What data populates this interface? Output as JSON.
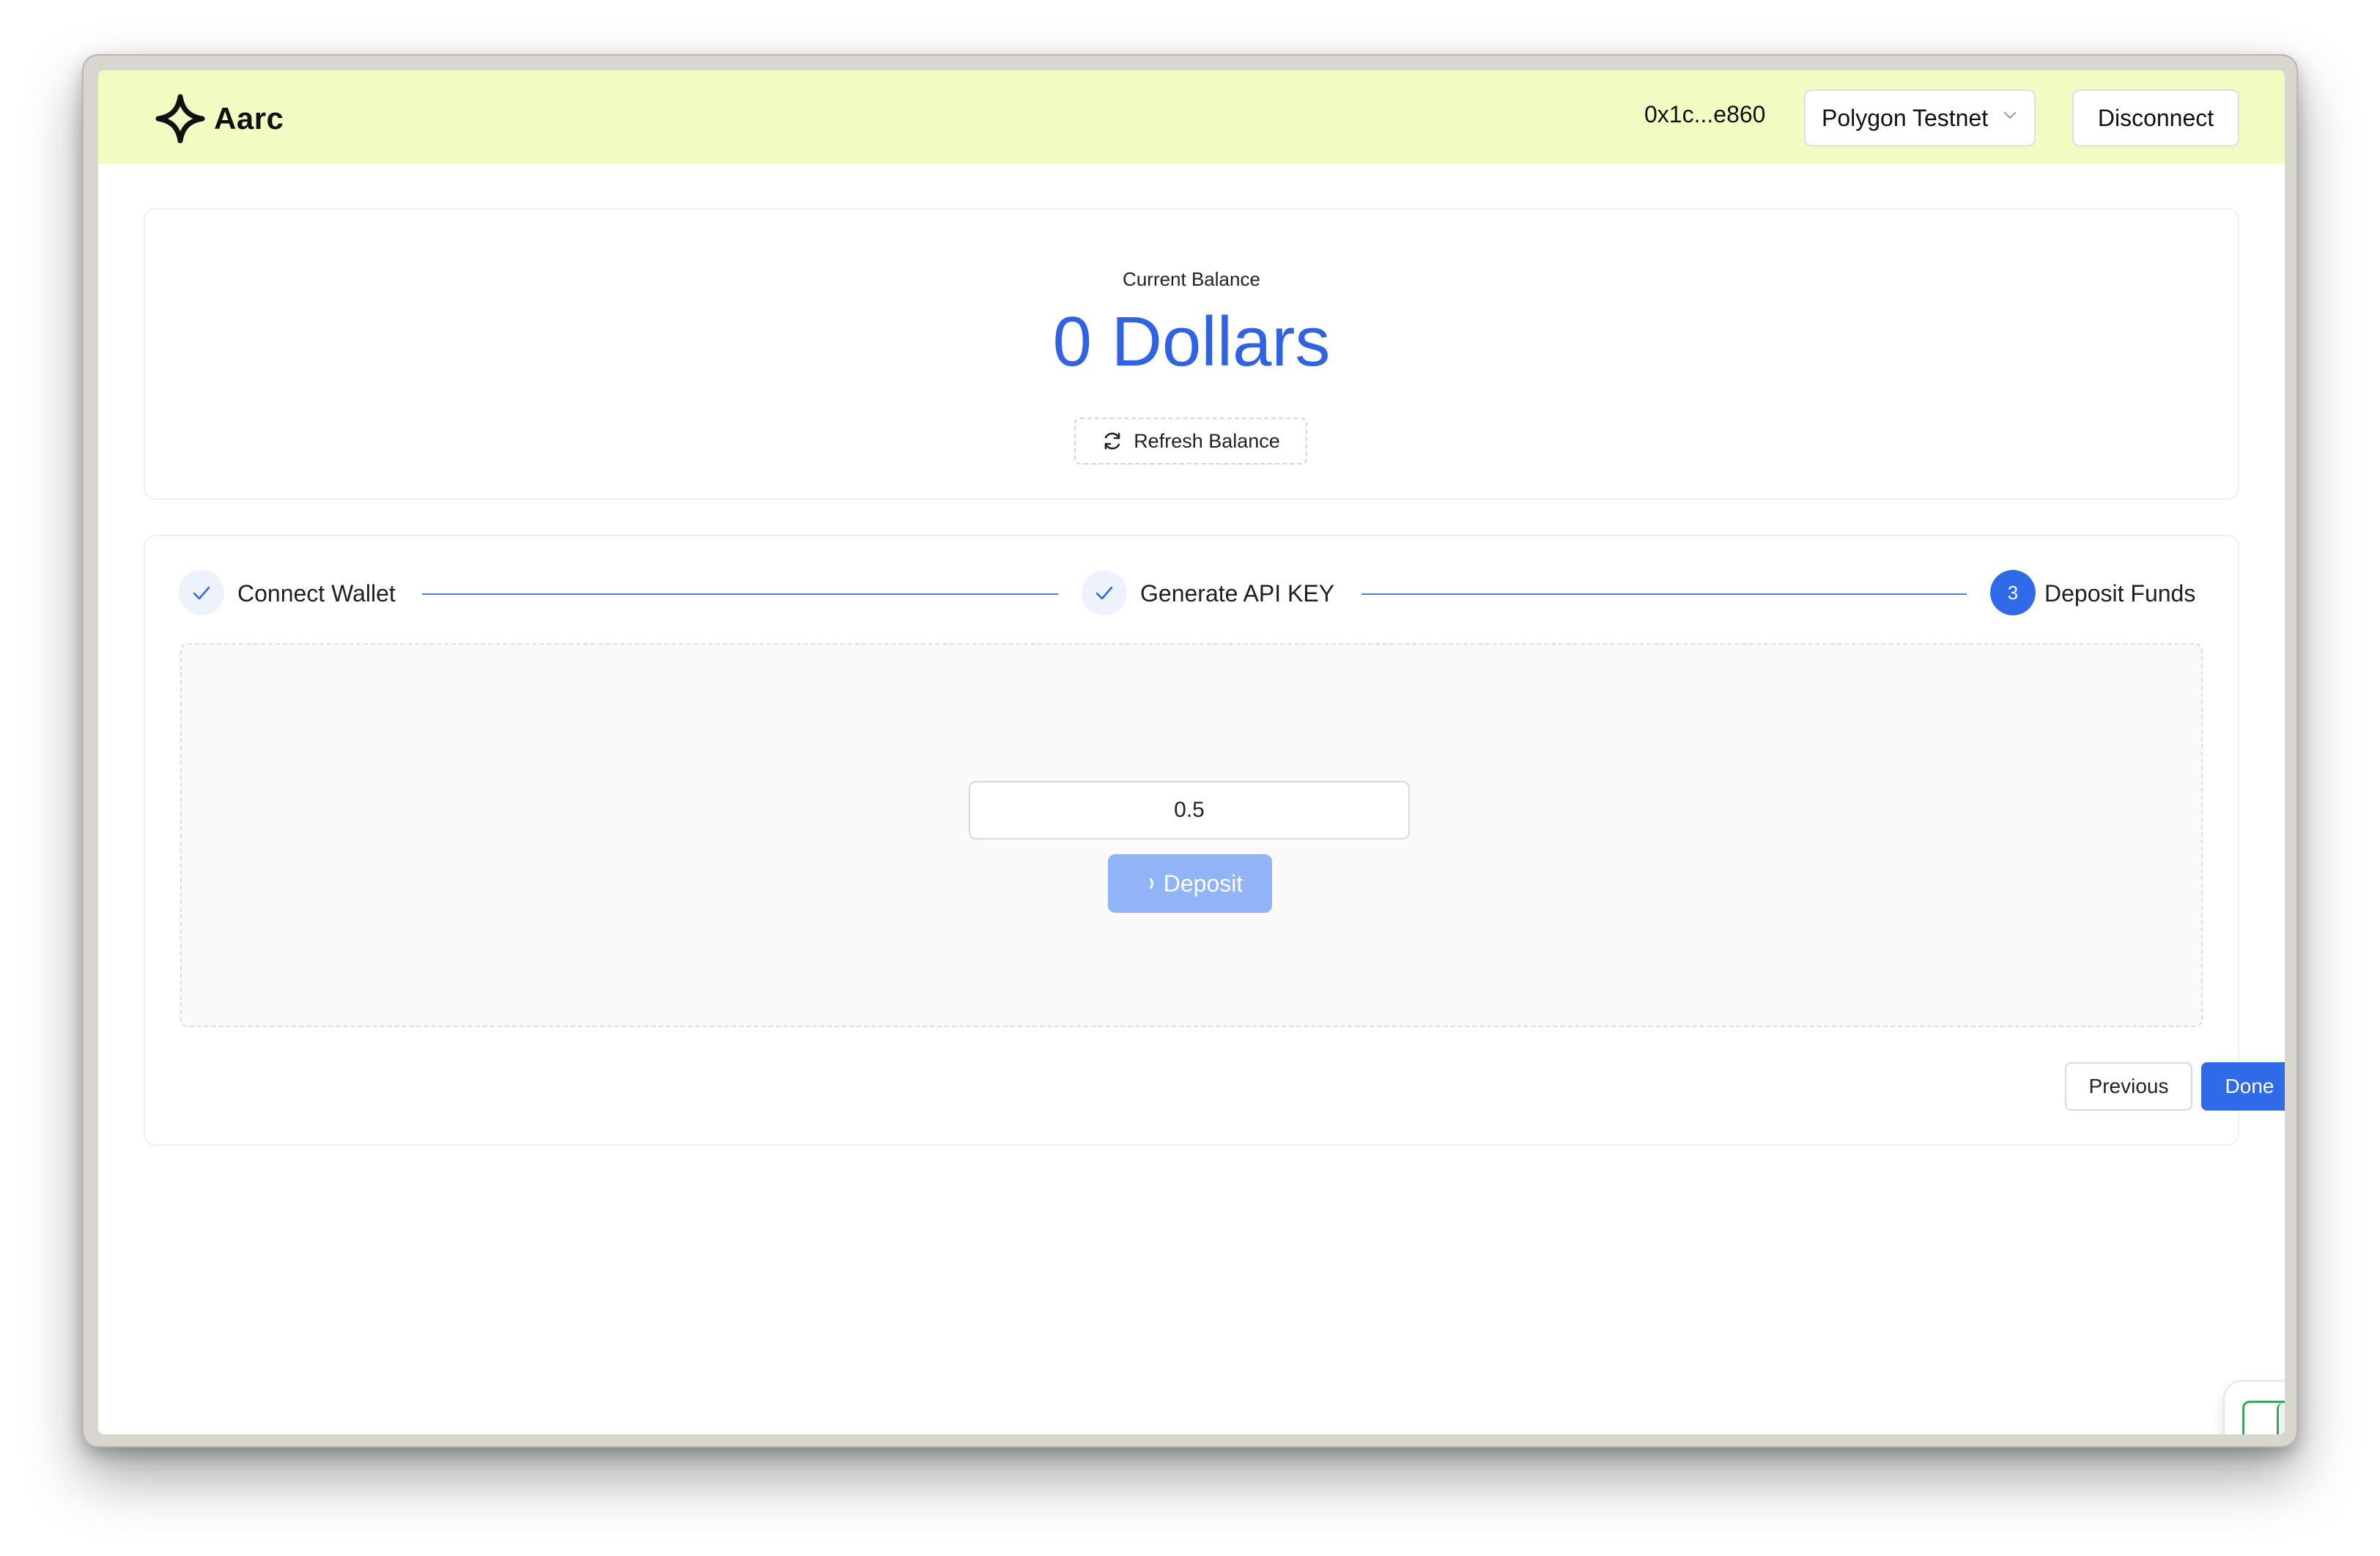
{
  "brand": {
    "name": "Aarc"
  },
  "header": {
    "wallet_address": "0x1c...e860",
    "network": "Polygon Testnet",
    "disconnect_label": "Disconnect"
  },
  "balance": {
    "label": "Current Balance",
    "value": "0 Dollars",
    "refresh_label": "Refresh Balance"
  },
  "steps": [
    {
      "label": "Connect Wallet",
      "status": "done"
    },
    {
      "label": "Generate API KEY",
      "status": "done"
    },
    {
      "label": "Deposit Funds",
      "status": "active",
      "number": "3"
    }
  ],
  "deposit": {
    "amount": "0.5",
    "button_label": "Deposit",
    "loading": true
  },
  "nav": {
    "previous_label": "Previous",
    "done_label": "Done"
  },
  "colors": {
    "accent": "#2f6ae8",
    "balance_text": "#2f63e3",
    "topbar_bg": "#f0fcc2",
    "deposit_disabled": "#91b4f7",
    "wallet_connected": "#3ba55c"
  },
  "icons": {
    "logo": "aarc-star-logo-icon",
    "refresh": "refresh-icon",
    "check": "check-icon",
    "chevron": "chevron-down-icon",
    "wallet": "metamask-fox-icon"
  }
}
